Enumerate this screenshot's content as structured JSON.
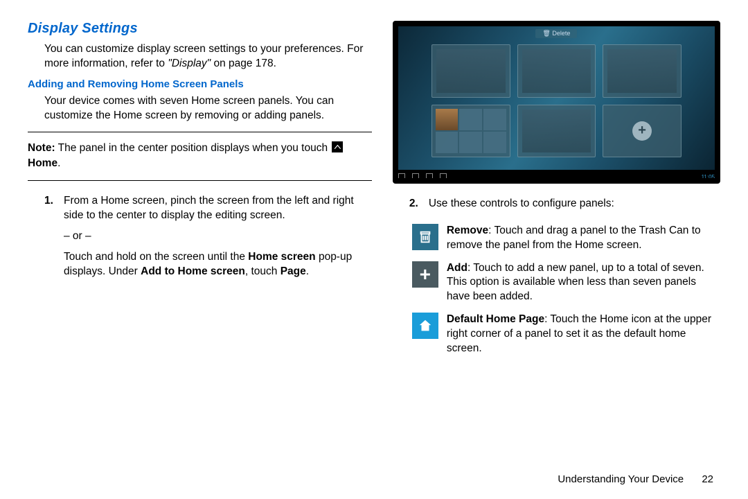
{
  "left": {
    "title": "Display Settings",
    "intro": "You can customize display screen settings to your preferences. For more information, refer to ",
    "intro_ref": "\"Display\"",
    "intro_tail": " on page 178.",
    "sub_heading": "Adding and Removing Home Screen Panels",
    "sub_intro": "Your device comes with seven Home screen panels. You can customize the Home screen by removing or adding panels.",
    "note_lead": "Note:",
    "note_text": " The panel in the center position displays when you touch ",
    "note_home": "Home",
    "step1_num": "1.",
    "step1_a": "From a Home screen, pinch the screen from the left and right side to the center to display the editing screen.",
    "step1_or": "– or –",
    "step1_b1": "Touch and hold on the screen until the ",
    "step1_b1_bold": "Home screen",
    "step1_b2": " pop-up displays. Under ",
    "step1_b2_bold": "Add to Home screen",
    "step1_b3": ", touch ",
    "step1_b3_bold": "Page",
    "step1_b4": "."
  },
  "right": {
    "screenshot_label": "Delete",
    "screenshot_time": "11:05",
    "step2_num": "2.",
    "step2_text": "Use these controls to configure panels:",
    "remove_bold": "Remove",
    "remove_text": ": Touch and drag a panel to the Trash Can to remove the panel from the Home screen.",
    "add_bold": "Add",
    "add_text": ": Touch to add a new panel, up to a total of seven. This option is available when less than seven panels have been added.",
    "home_bold": "Default Home Page",
    "home_text": ": Touch the Home icon at the upper right corner of a panel to set it as the default home screen."
  },
  "footer": {
    "section": "Understanding Your Device",
    "page": "22"
  }
}
